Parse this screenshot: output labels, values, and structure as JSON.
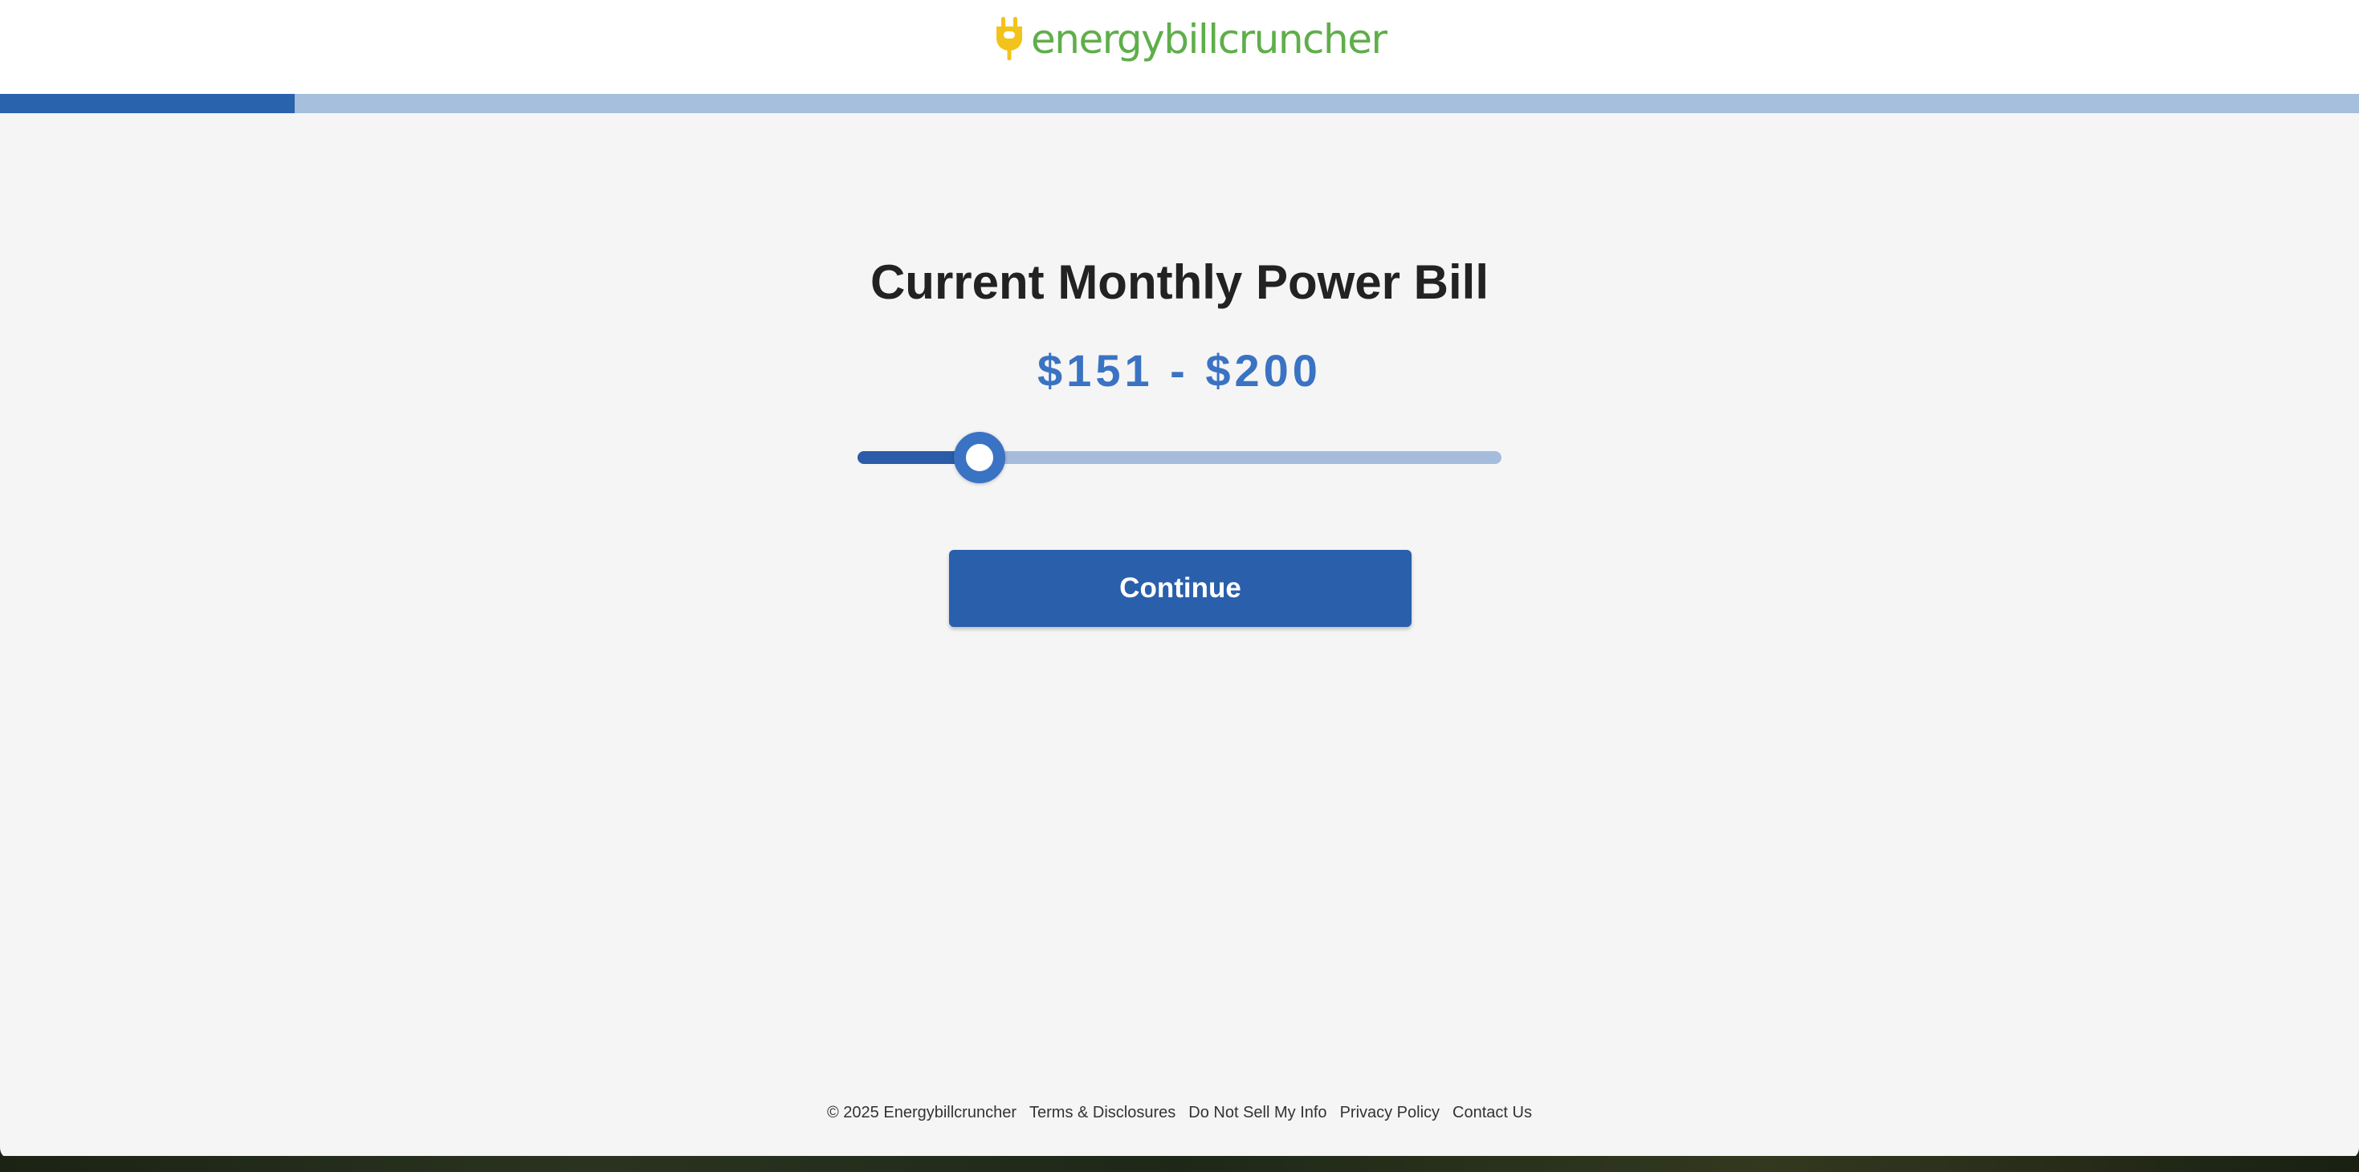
{
  "brand": {
    "name": "energybillcruncher",
    "icon": "plug-icon",
    "colors": {
      "logo_green": "#5fae4a",
      "logo_yellow": "#f2c31b"
    }
  },
  "progress": {
    "fraction": 0.125,
    "colors": {
      "fill": "#2962ad",
      "track": "#a5bfdc"
    }
  },
  "question": {
    "title": "Current Monthly Power Bill",
    "selected_value": "$151 - $200"
  },
  "slider": {
    "position": 0.19,
    "colors": {
      "fill": "#2b5ca8",
      "track": "#a6bcdd",
      "thumb": "#3a72c4"
    }
  },
  "actions": {
    "continue_label": "Continue",
    "button_color": "#2a5fab"
  },
  "footer": {
    "copyright": "© 2025 Energybillcruncher",
    "links": [
      "Terms & Disclosures",
      "Do Not Sell My Info",
      "Privacy Policy",
      "Contact Us"
    ]
  }
}
